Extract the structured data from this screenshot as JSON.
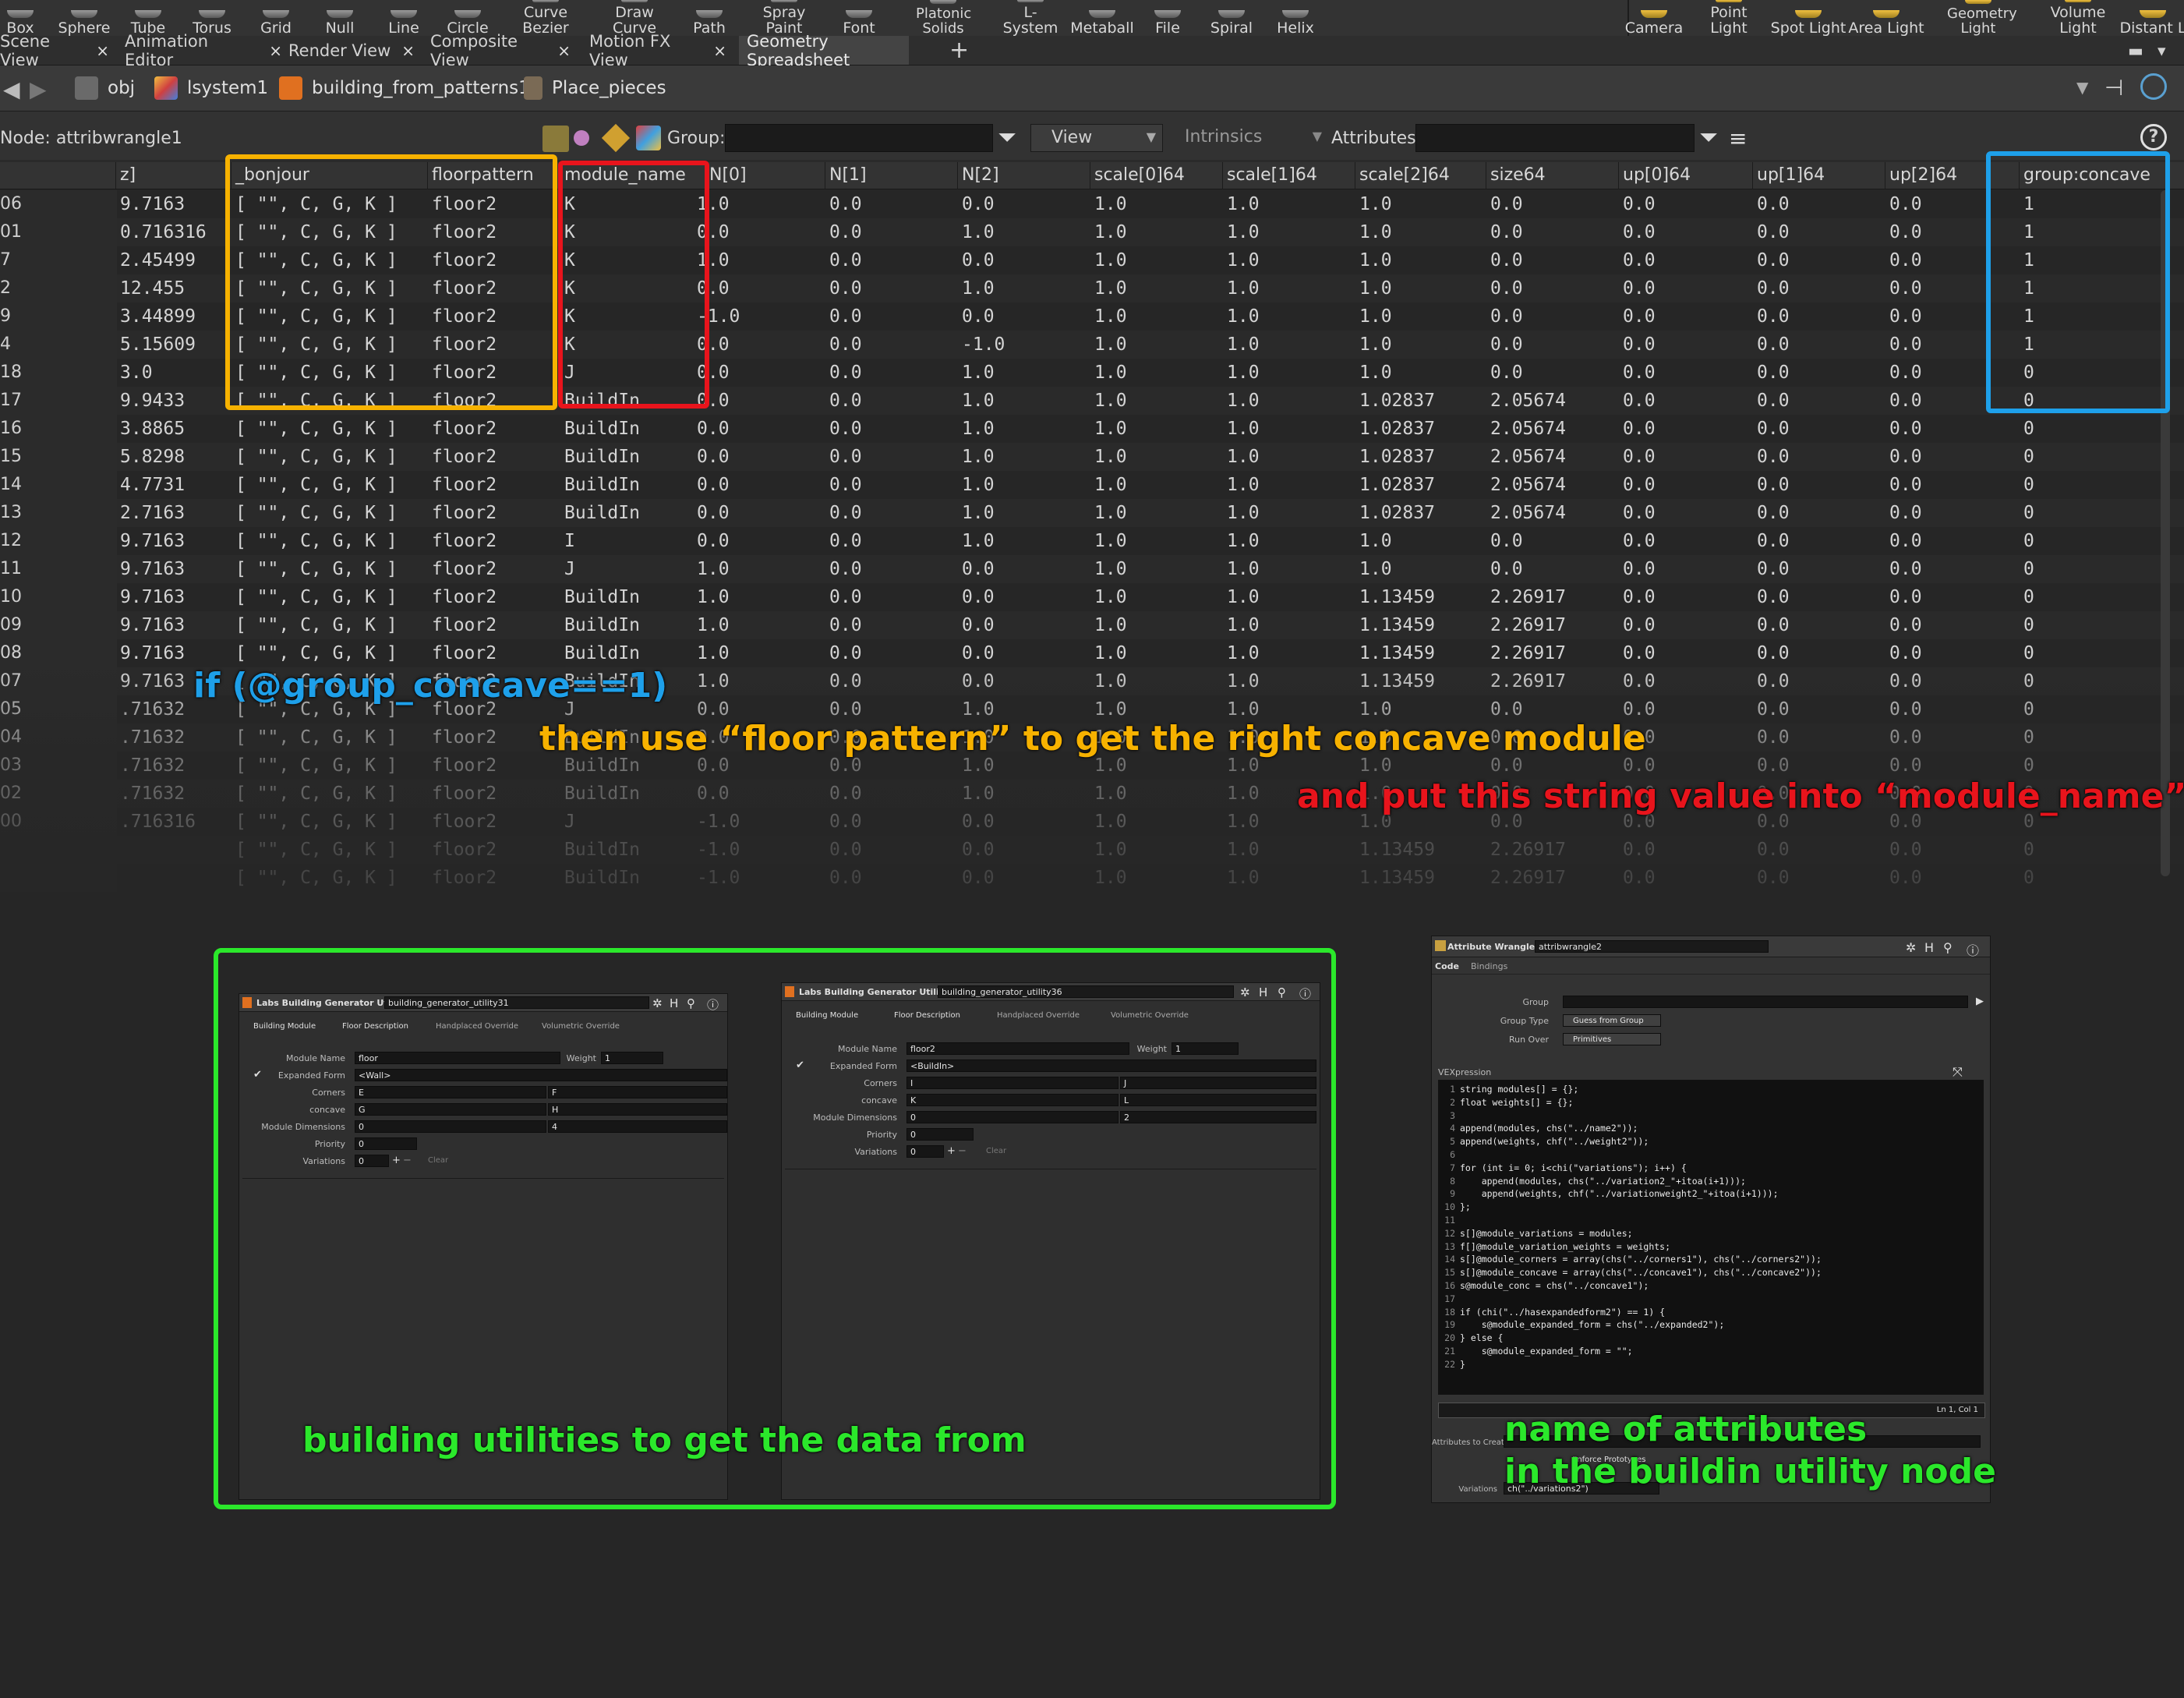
{
  "shelf": {
    "left_tools": [
      {
        "label": "Box",
        "icon": "box-icon"
      },
      {
        "label": "Sphere",
        "icon": "sphere-icon"
      },
      {
        "label": "Tube",
        "icon": "tube-icon"
      },
      {
        "label": "Torus",
        "icon": "torus-icon"
      },
      {
        "label": "Grid",
        "icon": "grid-icon"
      },
      {
        "label": "Null",
        "icon": "null-icon"
      },
      {
        "label": "Line",
        "icon": "line-icon"
      },
      {
        "label": "Circle",
        "icon": "circle-icon"
      },
      {
        "label": "Curve Bezier",
        "icon": "curve-bezier-icon"
      },
      {
        "label": "Draw Curve",
        "icon": "draw-curve-icon"
      },
      {
        "label": "Path",
        "icon": "path-icon"
      },
      {
        "label": "Spray Paint",
        "icon": "spray-paint-icon"
      },
      {
        "label": "Font",
        "icon": "font-icon"
      },
      {
        "label": "Platonic Solids",
        "icon": "platonic-solids-icon"
      },
      {
        "label": "L-System",
        "icon": "l-system-icon"
      },
      {
        "label": "Metaball",
        "icon": "metaball-icon"
      },
      {
        "label": "File",
        "icon": "file-icon"
      },
      {
        "label": "Spiral",
        "icon": "spiral-icon"
      },
      {
        "label": "Helix",
        "icon": "helix-icon"
      }
    ],
    "right_tools": [
      {
        "label": "Camera",
        "icon": "camera-icon"
      },
      {
        "label": "Point Light",
        "icon": "point-light-icon"
      },
      {
        "label": "Spot Light",
        "icon": "spot-light-icon"
      },
      {
        "label": "Area Light",
        "icon": "area-light-icon"
      },
      {
        "label": "Geometry Light",
        "icon": "geometry-light-icon"
      },
      {
        "label": "Volume Light",
        "icon": "volume-light-icon"
      },
      {
        "label": "Distant L",
        "icon": "distant-light-icon"
      }
    ]
  },
  "tabs": [
    {
      "label": "Scene View",
      "active": false
    },
    {
      "label": "Animation Editor",
      "active": false
    },
    {
      "label": "Render View",
      "active": false
    },
    {
      "label": "Composite View",
      "active": false
    },
    {
      "label": "Motion FX View",
      "active": false
    },
    {
      "label": "Geometry Spreadsheet",
      "active": true
    }
  ],
  "tab_add": "+",
  "tab_close": "×",
  "path": {
    "crumbs": [
      "obj",
      "lsystem1",
      "building_from_patterns1",
      "Place_pieces"
    ]
  },
  "nodebar": {
    "node_label": "Node: attribwrangle1",
    "group_label": "Group:",
    "view_label": "View",
    "intrinsics_label": "Intrinsics",
    "attributes_label": "Attributes:",
    "help": "?"
  },
  "sheet": {
    "headers": [
      "z]",
      "_bonjour",
      "floorpattern",
      "module_name",
      "N[0]",
      "N[1]",
      "N[2]",
      "scale[0]64",
      "scale[1]64",
      "scale[2]64",
      "size64",
      "up[0]64",
      "up[1]64",
      "up[2]64",
      "group:concave"
    ],
    "rows": [
      [
        "06",
        "9.7163",
        "[ \"\", C, G, K ]",
        "floor2",
        "K",
        "1.0",
        "0.0",
        "0.0",
        "1.0",
        "1.0",
        "1.0",
        "0.0",
        "0.0",
        "0.0",
        "0.0",
        "1"
      ],
      [
        "01",
        "0.716316",
        "[ \"\", C, G, K ]",
        "floor2",
        "K",
        "0.0",
        "0.0",
        "1.0",
        "1.0",
        "1.0",
        "1.0",
        "0.0",
        "0.0",
        "0.0",
        "0.0",
        "1"
      ],
      [
        "7",
        "2.45499",
        "[ \"\", C, G, K ]",
        "floor2",
        "K",
        "1.0",
        "0.0",
        "0.0",
        "1.0",
        "1.0",
        "1.0",
        "0.0",
        "0.0",
        "0.0",
        "0.0",
        "1"
      ],
      [
        "2",
        "12.455",
        "[ \"\", C, G, K ]",
        "floor2",
        "K",
        "0.0",
        "0.0",
        "1.0",
        "1.0",
        "1.0",
        "1.0",
        "0.0",
        "0.0",
        "0.0",
        "0.0",
        "1"
      ],
      [
        "9",
        "3.44899",
        "[ \"\", C, G, K ]",
        "floor2",
        "K",
        "-1.0",
        "0.0",
        "0.0",
        "1.0",
        "1.0",
        "1.0",
        "0.0",
        "0.0",
        "0.0",
        "0.0",
        "1"
      ],
      [
        "4",
        "5.15609",
        "[ \"\", C, G, K ]",
        "floor2",
        "K",
        "0.0",
        "0.0",
        "-1.0",
        "1.0",
        "1.0",
        "1.0",
        "0.0",
        "0.0",
        "0.0",
        "0.0",
        "1"
      ],
      [
        "18",
        "3.0",
        "[ \"\", C, G, K ]",
        "floor2",
        "J",
        "0.0",
        "0.0",
        "1.0",
        "1.0",
        "1.0",
        "1.0",
        "0.0",
        "0.0",
        "0.0",
        "0.0",
        "0"
      ],
      [
        "17",
        "9.9433",
        "[ \"\", C, G, K ]",
        "floor2",
        "BuildIn",
        "0.0",
        "0.0",
        "1.0",
        "1.0",
        "1.0",
        "1.02837",
        "2.05674",
        "0.0",
        "0.0",
        "0.0",
        "0"
      ],
      [
        "16",
        "3.8865",
        "[ \"\", C, G, K ]",
        "floor2",
        "BuildIn",
        "0.0",
        "0.0",
        "1.0",
        "1.0",
        "1.0",
        "1.02837",
        "2.05674",
        "0.0",
        "0.0",
        "0.0",
        "0"
      ],
      [
        "15",
        "5.8298",
        "[ \"\", C, G, K ]",
        "floor2",
        "BuildIn",
        "0.0",
        "0.0",
        "1.0",
        "1.0",
        "1.0",
        "1.02837",
        "2.05674",
        "0.0",
        "0.0",
        "0.0",
        "0"
      ],
      [
        "14",
        "4.7731",
        "[ \"\", C, G, K ]",
        "floor2",
        "BuildIn",
        "0.0",
        "0.0",
        "1.0",
        "1.0",
        "1.0",
        "1.02837",
        "2.05674",
        "0.0",
        "0.0",
        "0.0",
        "0"
      ],
      [
        "13",
        "2.7163",
        "[ \"\", C, G, K ]",
        "floor2",
        "BuildIn",
        "0.0",
        "0.0",
        "1.0",
        "1.0",
        "1.0",
        "1.02837",
        "2.05674",
        "0.0",
        "0.0",
        "0.0",
        "0"
      ],
      [
        "12",
        "9.7163",
        "[ \"\", C, G, K ]",
        "floor2",
        "I",
        "0.0",
        "0.0",
        "1.0",
        "1.0",
        "1.0",
        "1.0",
        "0.0",
        "0.0",
        "0.0",
        "0.0",
        "0"
      ],
      [
        "11",
        "9.7163",
        "[ \"\", C, G, K ]",
        "floor2",
        "J",
        "1.0",
        "0.0",
        "0.0",
        "1.0",
        "1.0",
        "1.0",
        "0.0",
        "0.0",
        "0.0",
        "0.0",
        "0"
      ],
      [
        "10",
        "9.7163",
        "[ \"\", C, G, K ]",
        "floor2",
        "BuildIn",
        "1.0",
        "0.0",
        "0.0",
        "1.0",
        "1.0",
        "1.13459",
        "2.26917",
        "0.0",
        "0.0",
        "0.0",
        "0"
      ],
      [
        "09",
        "9.7163",
        "[ \"\", C, G, K ]",
        "floor2",
        "BuildIn",
        "1.0",
        "0.0",
        "0.0",
        "1.0",
        "1.0",
        "1.13459",
        "2.26917",
        "0.0",
        "0.0",
        "0.0",
        "0"
      ],
      [
        "08",
        "9.7163",
        "[ \"\", C, G, K ]",
        "floor2",
        "BuildIn",
        "1.0",
        "0.0",
        "0.0",
        "1.0",
        "1.0",
        "1.13459",
        "2.26917",
        "0.0",
        "0.0",
        "0.0",
        "0"
      ],
      [
        "07",
        "9.7163",
        "[ \"\", C, G, K ]",
        "floor2",
        "BuildIn",
        "1.0",
        "0.0",
        "0.0",
        "1.0",
        "1.0",
        "1.13459",
        "2.26917",
        "0.0",
        "0.0",
        "0.0",
        "0"
      ],
      [
        "05",
        ".71632",
        "[ \"\", C, G, K ]",
        "floor2",
        "J",
        "0.0",
        "0.0",
        "1.0",
        "1.0",
        "1.0",
        "1.0",
        "0.0",
        "0.0",
        "0.0",
        "0.0",
        "0"
      ],
      [
        "04",
        ".71632",
        "[ \"\", C, G, K ]",
        "floor2",
        "BuildIn",
        "0.0",
        "0.0",
        "1.0",
        "1.0",
        "1.0",
        "1.0",
        "0.0",
        "0.0",
        "0.0",
        "0.0",
        "0"
      ],
      [
        "03",
        ".71632",
        "[ \"\", C, G, K ]",
        "floor2",
        "BuildIn",
        "0.0",
        "0.0",
        "1.0",
        "1.0",
        "1.0",
        "1.0",
        "0.0",
        "0.0",
        "0.0",
        "0.0",
        "0"
      ],
      [
        "02",
        ".71632",
        "[ \"\", C, G, K ]",
        "floor2",
        "BuildIn",
        "0.0",
        "0.0",
        "1.0",
        "1.0",
        "1.0",
        "1.0",
        "0.0",
        "0.0",
        "0.0",
        "0.0",
        "0"
      ],
      [
        "00",
        ".716316",
        "[ \"\", C, G, K ]",
        "floor2",
        "J",
        "-1.0",
        "0.0",
        "0.0",
        "1.0",
        "1.0",
        "1.0",
        "0.0",
        "0.0",
        "0.0",
        "0.0",
        "0"
      ],
      [
        "",
        "",
        "[ \"\", C, G, K ]",
        "floor2",
        "BuildIn",
        "-1.0",
        "0.0",
        "0.0",
        "1.0",
        "1.0",
        "1.13459",
        "2.26917",
        "0.0",
        "0.0",
        "0.0",
        "0"
      ],
      [
        "",
        "",
        "[ \"\", C, G, K ]",
        "floor2",
        "BuildIn",
        "-1.0",
        "0.0",
        "0.0",
        "1.0",
        "1.0",
        "1.13459",
        "2.26917",
        "0.0",
        "0.0",
        "0.0",
        "0"
      ]
    ]
  },
  "annotations": {
    "if_concave": "if (@group_concave==1)",
    "then_use": "then use “floor pattern” to get the right concave module",
    "and_put": "and put this string value into “module_name”",
    "building_utils": "building utilities to get the data from",
    "name_attrs_1": "name of attributes",
    "name_attrs_2": "in the buildin utility node",
    "colors": {
      "orange": "#f7b200",
      "red": "#e8141c",
      "blue": "#1ea0ea",
      "green": "#2be82b"
    }
  },
  "panel1": {
    "type": "Labs Building Generator Utility",
    "name": "building_generator_utility31",
    "tabs": [
      "Building Module",
      "Floor Description",
      "Handplaced Override",
      "Volumetric Override"
    ],
    "module_name_label": "Module Name",
    "module_name": "floor",
    "weight_label": "Weight",
    "weight": "1",
    "expanded_form_label": "Expanded Form",
    "expanded_form": "<Wall>",
    "corners_label": "Corners",
    "corners": [
      "E",
      "F"
    ],
    "concave_label": "concave",
    "concave": [
      "G",
      "H"
    ],
    "dims_label": "Module Dimensions",
    "dims": [
      "0",
      "4"
    ],
    "priority_label": "Priority",
    "priority": "0",
    "variations_label": "Variations",
    "variations": "0",
    "clear": "Clear"
  },
  "panel2": {
    "type": "Labs Building Generator Utility",
    "name": "building_generator_utility36",
    "tabs": [
      "Building Module",
      "Floor Description",
      "Handplaced Override",
      "Volumetric Override"
    ],
    "module_name_label": "Module Name",
    "module_name": "floor2",
    "weight_label": "Weight",
    "weight": "1",
    "expanded_form_label": "Expanded Form",
    "expanded_form": "<BuildIn>",
    "corners_label": "Corners",
    "corners": [
      "I",
      "J"
    ],
    "concave_label": "concave",
    "concave": [
      "K",
      "L"
    ],
    "dims_label": "Module Dimensions",
    "dims": [
      "0",
      "2"
    ],
    "priority_label": "Priority",
    "priority": "0",
    "variations_label": "Variations",
    "variations": "0",
    "clear": "Clear"
  },
  "wrangle": {
    "type": "Attribute Wrangle",
    "name": "attribwrangle2",
    "tabs": [
      "Code",
      "Bindings"
    ],
    "group_label": "Group",
    "group_type_label": "Group Type",
    "group_type": "Guess from Group",
    "run_over_label": "Run Over",
    "run_over": "Primitives",
    "vex_label": "VEXpression",
    "code": [
      "string modules[] = {};",
      "float weights[] = {};",
      "",
      "append(modules, chs(\"../name2\"));",
      "append(weights, chf(\"../weight2\"));",
      "",
      "for (int i= 0; i<chi(\"variations\"); i++) {",
      "    append(modules, chs(\"../variation2_\"+itoa(i+1)));",
      "    append(weights, chf(\"../variationweight2_\"+itoa(i+1)));",
      "};",
      "",
      "s[]@module_variations = modules;",
      "f[]@module_variation_weights = weights;",
      "s[]@module_corners = array(chs(\"../corners1\"), chs(\"../corners2\"));",
      "s[]@module_concave = array(chs(\"../concave1\"), chs(\"../concave2\"));",
      "s@module_conc = chs(\"../concave1\");",
      "",
      "if (chi(\"../hasexpandedform2\") == 1) {",
      "    s@module_expanded_form = chs(\"../expanded2\");",
      "} else {",
      "    s@module_expanded_form = \"\";",
      "}"
    ],
    "status": "Ln 1, Col 1",
    "attrs_to_create_label": "Attributes to Create",
    "enforce_label": "Enforce Prototypes",
    "variations_label": "Variations",
    "variations_value": "ch(\"../variations2\")"
  }
}
